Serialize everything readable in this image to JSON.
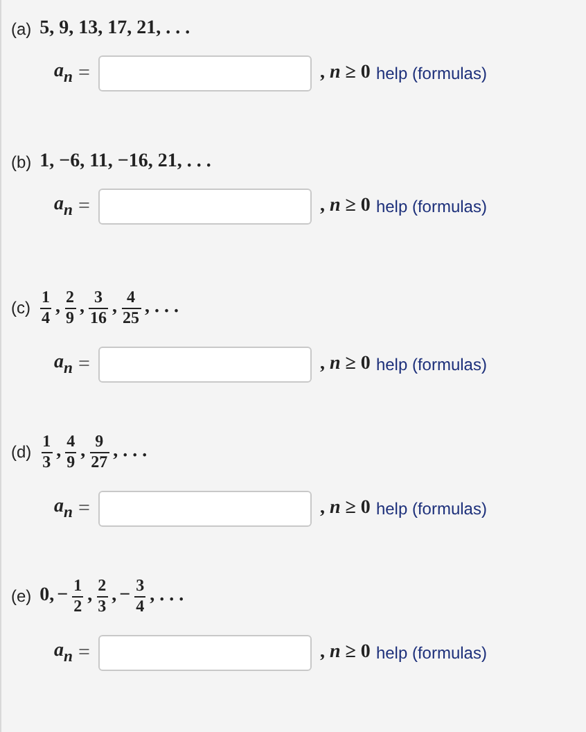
{
  "parts": [
    {
      "label": "(a)",
      "sequence": [
        {
          "kind": "text",
          "text": "5, 9, 13, 17, 21, . . ."
        }
      ],
      "answer": {
        "lhs": "a$_{n}$",
        "equals": "=",
        "condition": ", *n* ≥ 0",
        "help": "help (formulas)"
      }
    },
    {
      "label": "(b)",
      "sequence": [
        {
          "kind": "text",
          "text": "1, −6, 11, −16, 21, . . ."
        }
      ],
      "answer": {
        "lhs": "a$_{n}$",
        "equals": "=",
        "condition": ", *n* ≥ 0",
        "help": "help (formulas)"
      }
    },
    {
      "label": "(c)",
      "sequence": [
        {
          "kind": "fraction",
          "num": "1",
          "den": "4"
        },
        {
          "kind": "text",
          "text": ","
        },
        {
          "kind": "fraction",
          "num": "2",
          "den": "9"
        },
        {
          "kind": "text",
          "text": ","
        },
        {
          "kind": "fraction",
          "num": "3",
          "den": "16"
        },
        {
          "kind": "text",
          "text": ","
        },
        {
          "kind": "fraction",
          "num": "4",
          "den": "25"
        },
        {
          "kind": "text",
          "text": ", . . ."
        }
      ],
      "answer": {
        "lhs": "a$_{n}$",
        "equals": "=",
        "condition": ", *n* ≥ 0",
        "help": "help (formulas)"
      }
    },
    {
      "label": "(d)",
      "sequence": [
        {
          "kind": "fraction",
          "num": "1",
          "den": "3"
        },
        {
          "kind": "text",
          "text": ","
        },
        {
          "kind": "fraction",
          "num": "4",
          "den": "9"
        },
        {
          "kind": "text",
          "text": ","
        },
        {
          "kind": "fraction",
          "num": "9",
          "den": "27"
        },
        {
          "kind": "text",
          "text": ", . . ."
        }
      ],
      "answer": {
        "lhs": "a$_{n}$",
        "equals": "=",
        "condition": ", *n* ≥ 0",
        "help": "help (formulas)"
      }
    },
    {
      "label": "(e)",
      "sequence": [
        {
          "kind": "text",
          "text": "0,"
        },
        {
          "kind": "text",
          "text": "−"
        },
        {
          "kind": "fraction",
          "num": "1",
          "den": "2"
        },
        {
          "kind": "text",
          "text": ","
        },
        {
          "kind": "fraction",
          "num": "2",
          "den": "3"
        },
        {
          "kind": "text",
          "text": ","
        },
        {
          "kind": "text",
          "text": "−"
        },
        {
          "kind": "fraction",
          "num": "3",
          "den": "4"
        },
        {
          "kind": "text",
          "text": ", . . ."
        }
      ],
      "answer": {
        "lhs": "a$_{n}$",
        "equals": "=",
        "condition": ", *n* ≥ 0",
        "help": "help (formulas)"
      }
    }
  ]
}
